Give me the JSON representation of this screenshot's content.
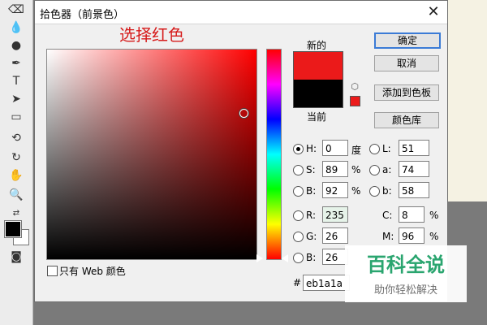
{
  "dialog": {
    "title": "拾色器（前景色）",
    "close_label": "✕",
    "annotation": "选择红色",
    "label_new": "新的",
    "label_current": "当前",
    "buttons": {
      "ok": "确定",
      "cancel": "取消",
      "add_swatch": "添加到色板",
      "color_library": "颜色库"
    },
    "fields": {
      "H": {
        "label": "H:",
        "value": "0",
        "unit": "度",
        "selected": true
      },
      "S": {
        "label": "S:",
        "value": "89",
        "unit": "%"
      },
      "B": {
        "label": "B:",
        "value": "92",
        "unit": "%"
      },
      "R": {
        "label": "R:",
        "value": "235"
      },
      "G": {
        "label": "G:",
        "value": "26"
      },
      "Bl": {
        "label": "B:",
        "value": "26"
      },
      "L": {
        "label": "L:",
        "value": "51"
      },
      "a": {
        "label": "a:",
        "value": "74"
      },
      "b": {
        "label": "b:",
        "value": "58"
      },
      "C": {
        "label": "C:",
        "value": "8",
        "unit": "%"
      },
      "M": {
        "label": "M:",
        "value": "96",
        "unit": "%"
      }
    },
    "hex": {
      "label": "#",
      "value": "eb1a1a"
    },
    "web_only_label": "只有 Web 颜色",
    "colors": {
      "new": "#eb1a1a",
      "current": "#000000",
      "warning": "#eb1a1a"
    }
  },
  "watermark": {
    "main": "百科全说",
    "sub": "助你轻松解决"
  }
}
